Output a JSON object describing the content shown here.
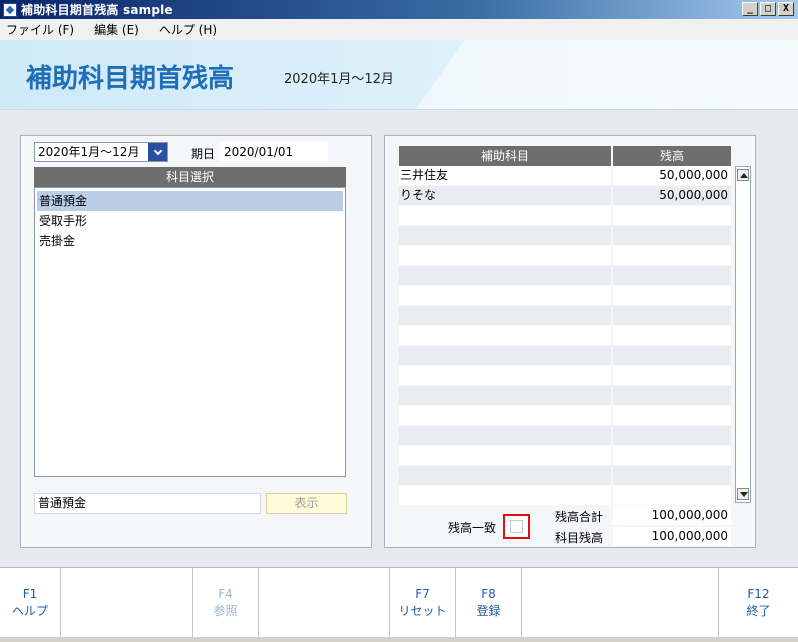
{
  "window": {
    "title": "補助科目期首残高 sample",
    "min_label": "_",
    "max_label": "□",
    "close_label": "X"
  },
  "menu": [
    {
      "label": "ファイル (F)"
    },
    {
      "label": "編集 (E)"
    },
    {
      "label": "ヘルプ (H)"
    }
  ],
  "header": {
    "title": "補助科目期首残高",
    "period": "2020年1月～12月"
  },
  "left": {
    "period_select": "2020年1月～12月",
    "date_label": "期日",
    "date_value": "2020/01/01",
    "list_header": "科目選択",
    "items": [
      "普通預金",
      "受取手形",
      "売掛金"
    ],
    "selected_index": 0,
    "selected_value": "普通預金",
    "show_button": "表示"
  },
  "right": {
    "col_name": "補助科目",
    "col_amount": "残高",
    "rows": [
      {
        "name": "三井住友",
        "amount": "50,000,000"
      },
      {
        "name": "りそな",
        "amount": "50,000,000"
      },
      {
        "name": "",
        "amount": ""
      },
      {
        "name": "",
        "amount": ""
      },
      {
        "name": "",
        "amount": ""
      },
      {
        "name": "",
        "amount": ""
      },
      {
        "name": "",
        "amount": ""
      },
      {
        "name": "",
        "amount": ""
      },
      {
        "name": "",
        "amount": ""
      },
      {
        "name": "",
        "amount": ""
      },
      {
        "name": "",
        "amount": ""
      },
      {
        "name": "",
        "amount": ""
      },
      {
        "name": "",
        "amount": ""
      },
      {
        "name": "",
        "amount": ""
      },
      {
        "name": "",
        "amount": ""
      },
      {
        "name": "",
        "amount": ""
      },
      {
        "name": "",
        "amount": ""
      }
    ],
    "match_label": "残高一致",
    "match_checked": false,
    "total_label": "残高合計",
    "total_value": "100,000,000",
    "account_balance_label": "科目残高",
    "account_balance_value": "100,000,000"
  },
  "fkeys": [
    {
      "key": "F1",
      "label": "ヘルプ",
      "enabled": true
    },
    {
      "key": "",
      "label": "",
      "enabled": false
    },
    {
      "key": "F4",
      "label": "参照",
      "enabled": false
    },
    {
      "key": "",
      "label": "",
      "enabled": false
    },
    {
      "key": "F7",
      "label": "リセット",
      "enabled": true
    },
    {
      "key": "F8",
      "label": "登録",
      "enabled": true
    },
    {
      "key": "",
      "label": "",
      "enabled": false
    },
    {
      "key": "F12",
      "label": "終了",
      "enabled": true
    }
  ],
  "colors": {
    "header_title": "#1e6fb8",
    "fkey_text": "#1e5aa8",
    "select_button": "#2b4fa0",
    "highlight_border": "#e01010"
  }
}
